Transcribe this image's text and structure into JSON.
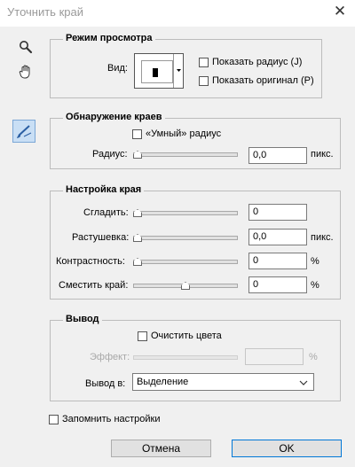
{
  "window": {
    "title": "Уточнить край",
    "close_glyph": "✕"
  },
  "tools": [
    {
      "name": "zoom-icon"
    },
    {
      "name": "hand-icon"
    },
    {
      "name": "refine-radius-brush-icon",
      "active": true
    }
  ],
  "view_mode": {
    "legend": "Режим просмотра",
    "view_label": "Вид:",
    "show_radius": "Показать радиус (J)",
    "show_original": "Показать оригинал (P)"
  },
  "edge_detection": {
    "legend": "Обнаружение краев",
    "smart_radius": "«Умный» радиус",
    "radius_label": "Радиус:",
    "radius_value": "0,0",
    "radius_unit": "пикс.",
    "radius_level": 0
  },
  "adjust_edge": {
    "legend": "Настройка края",
    "smooth": {
      "label": "Сгладить:",
      "value": "0",
      "unit": "",
      "level": 0
    },
    "feather": {
      "label": "Растушевка:",
      "value": "0,0",
      "unit": "пикс.",
      "level": 0
    },
    "contrast": {
      "label": "Контрастность:",
      "value": "0",
      "unit": "%",
      "level": 0
    },
    "shift_edge": {
      "label": "Сместить край:",
      "value": "0",
      "unit": "%",
      "level": 0.5
    }
  },
  "output": {
    "legend": "Вывод",
    "decontaminate": "Очистить цвета",
    "amount_label": "Эффект:",
    "amount_unit": "%",
    "output_to_label": "Вывод в:",
    "output_to_value": "Выделение"
  },
  "remember": "Запомнить настройки",
  "buttons": {
    "cancel": "Отмена",
    "ok": "OK"
  },
  "colors": {
    "accent": "#0078d7",
    "tool_active_bg": "#c9dff5"
  }
}
